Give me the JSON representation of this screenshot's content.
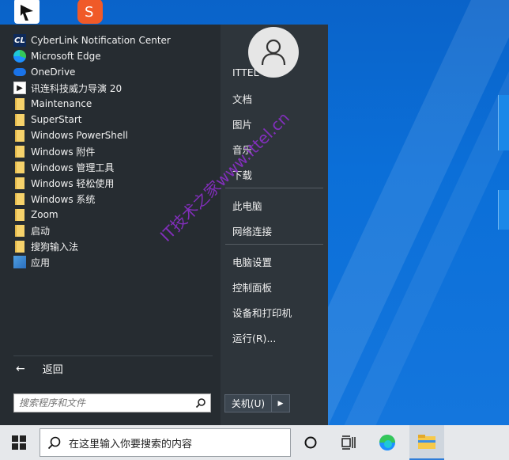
{
  "start_menu": {
    "programs": [
      {
        "label": "CyberLink Notification Center",
        "icon": "cyberlink-icon"
      },
      {
        "label": "Microsoft Edge",
        "icon": "edge-icon"
      },
      {
        "label": "OneDrive",
        "icon": "onedrive-icon"
      },
      {
        "label": "讯连科技威力导演 20",
        "icon": "powerdirector-icon"
      },
      {
        "label": "Maintenance",
        "icon": "folder-icon"
      },
      {
        "label": "SuperStart",
        "icon": "folder-icon"
      },
      {
        "label": "Windows PowerShell",
        "icon": "folder-icon"
      },
      {
        "label": "Windows 附件",
        "icon": "folder-icon"
      },
      {
        "label": "Windows 管理工具",
        "icon": "folder-icon"
      },
      {
        "label": "Windows 轻松使用",
        "icon": "folder-icon"
      },
      {
        "label": "Windows 系统",
        "icon": "folder-icon"
      },
      {
        "label": "Zoom",
        "icon": "folder-icon"
      },
      {
        "label": "启动",
        "icon": "folder-icon"
      },
      {
        "label": "搜狗输入法",
        "icon": "folder-icon"
      },
      {
        "label": "应用",
        "icon": "apps-icon"
      }
    ],
    "back_label": "返回",
    "search_placeholder": "搜索程序和文件",
    "right_items": {
      "user": "ITTEL",
      "documents": "文档",
      "pictures": "图片",
      "music": "音乐",
      "downloads": "下载",
      "this_pc": "此电脑",
      "network": "网络连接",
      "pc_settings": "电脑设置",
      "control_panel": "控制面板",
      "devices_printers": "设备和打印机",
      "run": "运行(R)..."
    },
    "shutdown_label": "关机(U)",
    "watermark": "IT技术之家www.ittel.cn"
  },
  "taskbar": {
    "search_text": "在这里输入你要搜索的内容"
  },
  "colors": {
    "desktop": "#0b6fd8",
    "menu_left": "#262c31",
    "menu_right": "#2e353b",
    "taskbar": "#e6e8eb",
    "watermark": "#8b2fc9"
  }
}
